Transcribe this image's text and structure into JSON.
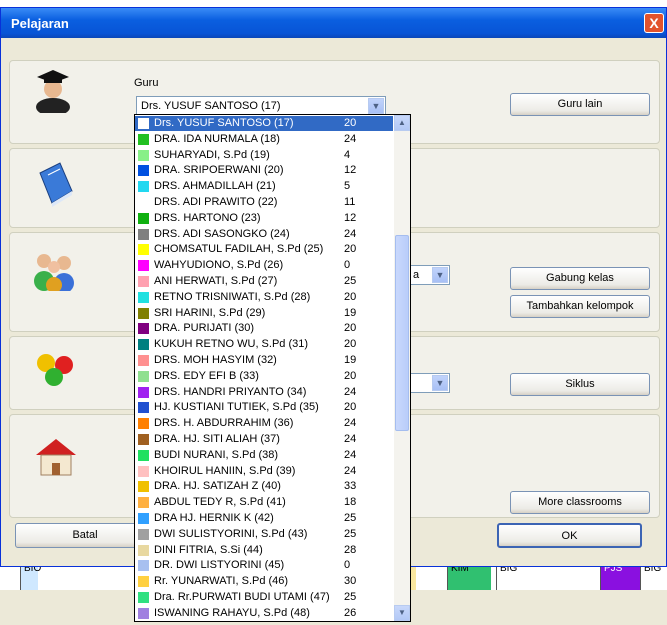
{
  "window": {
    "title": "Pelajaran",
    "close_label": "X"
  },
  "guru": {
    "label": "Guru",
    "selected": "Drs. YUSUF SANTOSO (17)",
    "guru_lain_label": "Guru lain"
  },
  "buttons": {
    "gabung_kelas": "Gabung kelas",
    "tambahkan_kelompok": "Tambahkan kelompok",
    "siklus": "Siklus",
    "more_classrooms": "More classrooms",
    "batal": "Batal",
    "ok": "OK"
  },
  "partial_text": {
    "class_combo_fragment": "a"
  },
  "under_grid": [
    "BIO",
    "BIO",
    "KIM",
    "BIG",
    "PJS",
    "BIG"
  ],
  "teachers": [
    {
      "name": "Drs. YUSUF SANTOSO (17)",
      "count": "20",
      "color": "#ffffff",
      "selected": true
    },
    {
      "name": "DRA. IDA NURMALA (18)",
      "count": "24",
      "color": "#22c022"
    },
    {
      "name": "SUHARYADI, S.Pd (19)",
      "count": "4",
      "color": "#88f088"
    },
    {
      "name": "DRA. SRIPOERWANI (20)",
      "count": "12",
      "color": "#0050e0"
    },
    {
      "name": "DRS. AHMADILLAH (21)",
      "count": "5",
      "color": "#22d8f0"
    },
    {
      "name": "DRS. ADI PRAWITO (22)",
      "count": "11",
      "color": "#ffffff"
    },
    {
      "name": "DRS. HARTONO (23)",
      "count": "12",
      "color": "#10b010"
    },
    {
      "name": "DRS. ADI SASONGKO (24)",
      "count": "24",
      "color": "#808080"
    },
    {
      "name": "CHOMSATUL FADILAH, S.Pd (25)",
      "count": "20",
      "color": "#ffff00"
    },
    {
      "name": "WAHYUDIONO, S.Pd (26)",
      "count": "0",
      "color": "#ff00ff"
    },
    {
      "name": "ANI HERWATI, S.Pd (27)",
      "count": "25",
      "color": "#ffa0b0"
    },
    {
      "name": "RETNO TRISNIWATI, S.Pd (28)",
      "count": "20",
      "color": "#20e0e0"
    },
    {
      "name": "SRI HARINI, S.Pd (29)",
      "count": "19",
      "color": "#808000"
    },
    {
      "name": "DRA. PURIJATI (30)",
      "count": "20",
      "color": "#800080"
    },
    {
      "name": "KUKUH RETNO WU, S.Pd (31)",
      "count": "20",
      "color": "#008080"
    },
    {
      "name": "DRS. MOH HASYIM (32)",
      "count": "19",
      "color": "#ff9090"
    },
    {
      "name": "DRS. EDY EFI B (33)",
      "count": "20",
      "color": "#90e090"
    },
    {
      "name": "DRS. HANDRI PRIYANTO (34)",
      "count": "24",
      "color": "#a020f0"
    },
    {
      "name": "HJ. KUSTIANI TUTIEK, S.Pd (35)",
      "count": "20",
      "color": "#2050d0"
    },
    {
      "name": "DRS. H. ABDURRAHIM (36)",
      "count": "24",
      "color": "#ff8000"
    },
    {
      "name": "DRA. HJ. SITI ALIAH (37)",
      "count": "24",
      "color": "#a06020"
    },
    {
      "name": "BUDI NURANI, S.Pd (38)",
      "count": "24",
      "color": "#20e060"
    },
    {
      "name": "KHOIRUL HANIIN, S.Pd (39)",
      "count": "24",
      "color": "#ffc0c0"
    },
    {
      "name": "DRA. HJ. SATIZAH Z (40)",
      "count": "33",
      "color": "#f0c000"
    },
    {
      "name": "ABDUL TEDY R, S.Pd (41)",
      "count": "18",
      "color": "#ffb040"
    },
    {
      "name": "DRA HJ. HERNIK K (42)",
      "count": "25",
      "color": "#30a0ff"
    },
    {
      "name": "DWI SULISTYORINI, S.Pd (43)",
      "count": "25",
      "color": "#a0a0a0"
    },
    {
      "name": "DINI FITRIA, S.Si (44)",
      "count": "28",
      "color": "#e8d8a0"
    },
    {
      "name": "DR. DWI LISTYORINI (45)",
      "count": "0",
      "color": "#a8c0f0"
    },
    {
      "name": "Rr. YUNARWATI, S.Pd (46)",
      "count": "30",
      "color": "#ffd040"
    },
    {
      "name": "Dra. Rr.PURWATI BUDI UTAMI (47)",
      "count": "25",
      "color": "#30e080"
    },
    {
      "name": "ISWANING RAHAYU, S.Pd (48)",
      "count": "26",
      "color": "#a080e0"
    }
  ],
  "icons": [
    "graduate-icon",
    "book-icon",
    "people-icon",
    "balls-icon",
    "house-icon"
  ]
}
